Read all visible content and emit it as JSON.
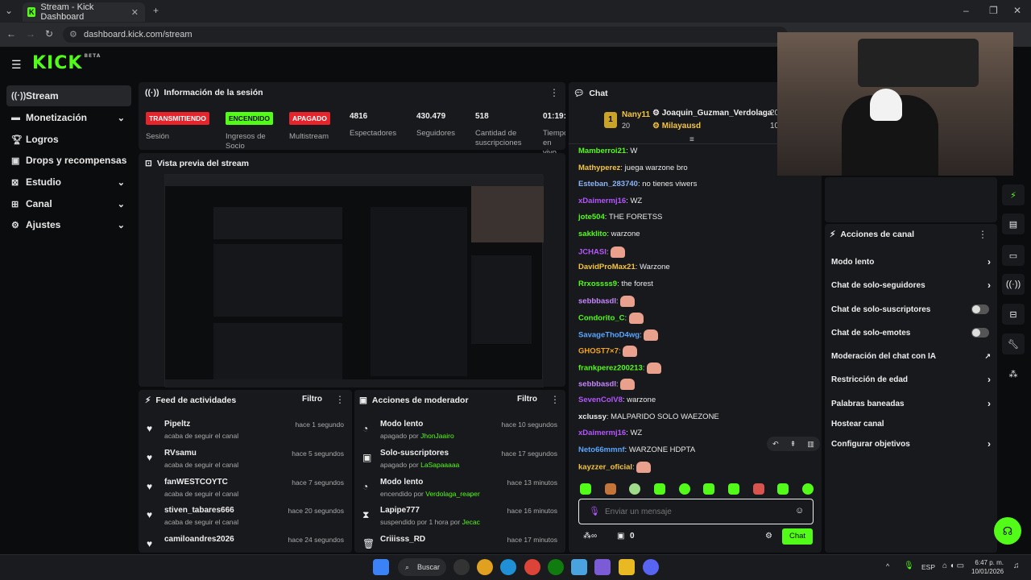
{
  "browser": {
    "tab_title": "Stream - Kick Dashboard",
    "url": "dashboard.kick.com/stream",
    "favicon": "K"
  },
  "logo": {
    "text": "KICK",
    "beta": "BETA"
  },
  "sidebar": {
    "items": [
      {
        "label": "Stream",
        "icon": "radio-icon"
      },
      {
        "label": "Monetización",
        "icon": "money-icon"
      },
      {
        "label": "Logros",
        "icon": "trophy-icon"
      },
      {
        "label": "Drops y recompensas",
        "icon": "gift-icon"
      },
      {
        "label": "Estudio",
        "icon": "studio-icon"
      },
      {
        "label": "Canal",
        "icon": "channel-icon"
      },
      {
        "label": "Ajustes",
        "icon": "gear-icon"
      }
    ]
  },
  "session": {
    "title": "Información de la sesión",
    "badges": [
      {
        "text": "TRANSMITIENDO",
        "label": "Sesión",
        "color": "#e5242c",
        "textcolor": "#ffffff"
      },
      {
        "text": "ENCENDIDO",
        "label": "Ingresos de Socio",
        "color": "#53fc18",
        "textcolor": "#0b0c0e"
      },
      {
        "text": "APAGADO",
        "label": "Multistream",
        "color": "#e5242c",
        "textcolor": "#ffffff"
      }
    ],
    "stats": [
      {
        "value": "4816",
        "label": "Espectadores"
      },
      {
        "value": "430.479",
        "label": "Seguidores"
      },
      {
        "value": "518",
        "label": "Cantidad de suscripciones"
      },
      {
        "value": "01:19:",
        "label": "Tiempo en vivo"
      }
    ]
  },
  "preview": {
    "title": "Vista previa del stream"
  },
  "feed": {
    "title": "Feed de actividades",
    "filter": "Filtro",
    "items": [
      {
        "name": "Pipeltz",
        "sub": "acaba de seguir el canal",
        "time": "hace 1 segundo"
      },
      {
        "name": "RVsamu",
        "sub": "acaba de seguir el canal",
        "time": "hace 5 segundos"
      },
      {
        "name": "fanWESTCOYTC",
        "sub": "acaba de seguir el canal",
        "time": "hace 7 segundos"
      },
      {
        "name": "stiven_tabares666",
        "sub": "acaba de seguir el canal",
        "time": "hace 20 segundos"
      },
      {
        "name": "camiloandres2026",
        "sub": "acaba de seguir el canal",
        "time": "hace 24 segundos"
      }
    ]
  },
  "modactions": {
    "title": "Acciones de moderador",
    "filter": "Filtro",
    "items": [
      {
        "name": "Modo lento",
        "sub_pre": "apagado por ",
        "sub_user": "JhonJaairo",
        "time": "hace 10 segundos"
      },
      {
        "name": "Solo-suscriptores",
        "sub_pre": "apagado por ",
        "sub_user": "LaSapaaaaa",
        "time": "hace 17 segundos"
      },
      {
        "name": "Modo lento",
        "sub_pre": "encendido por ",
        "sub_user": "Verdolaga_reaper",
        "time": "hace 13 minutos"
      },
      {
        "name": "Lapipe777",
        "sub_pre": "suspendido por 1 hora por ",
        "sub_user": "Jecac",
        "time": "hace 16 minutos"
      },
      {
        "name": "Criiisss_RD",
        "sub_pre": "",
        "sub_user": "",
        "time": "hace 17 minutos"
      }
    ]
  },
  "chat": {
    "title": "Chat",
    "pinned": {
      "rank": "1",
      "user": "Nany11",
      "count": "20",
      "user2": "Joaquin_Guzman_Verdolaga",
      "count2": "20",
      "user3": "Milayausd",
      "count3": "10"
    },
    "messages": [
      {
        "user": "Mamberroi21",
        "color": "#53fc18",
        "text": "W"
      },
      {
        "user": "Mathyperez",
        "color": "#f5c542",
        "text": "juega warzone bro"
      },
      {
        "user": "Esteban_283740",
        "color": "#8ab4f8",
        "text": "no tienes viwers"
      },
      {
        "user": "xDaimermj16",
        "color": "#b455ff",
        "text": "WZ"
      },
      {
        "user": "jote504",
        "color": "#53fc18",
        "text": "THE FORETSS"
      },
      {
        "user": "sakklito",
        "color": "#53fc18",
        "text": "warzone"
      },
      {
        "user": "JCHASI",
        "color": "#b455ff",
        "text": ""
      },
      {
        "user": "DavidProMax21",
        "color": "#f5c542",
        "text": "Warzone"
      },
      {
        "user": "Rrxossss9",
        "color": "#53fc18",
        "text": "the forest"
      },
      {
        "user": "sebbbasdl",
        "color": "#c686ff",
        "text": ""
      },
      {
        "user": "Condorito_C",
        "color": "#53fc18",
        "text": ""
      },
      {
        "user": "SavageThoD4wg",
        "color": "#58a6ff",
        "text": ""
      },
      {
        "user": "GHOST7×7",
        "color": "#f5a623",
        "text": ""
      },
      {
        "user": "frankperez200213",
        "color": "#53fc18",
        "text": ""
      },
      {
        "user": "sebbbasdl",
        "color": "#c686ff",
        "text": ""
      },
      {
        "user": "SevenColV8",
        "color": "#b455ff",
        "text": "warzone"
      },
      {
        "user": "xclussy",
        "color": "#eeeeee",
        "text": "MALPARIDO SOLO WAEZONE"
      },
      {
        "user": "xDaimermj16",
        "color": "#b455ff",
        "text": "WZ"
      },
      {
        "user": "Neto66mmnf",
        "color": "#58a6ff",
        "text": "WARZONE HDPTA"
      },
      {
        "user": "kayzzer_oficial",
        "color": "#f5c542",
        "text": ""
      }
    ],
    "input_placeholder": "Enviar un mensaje",
    "send_label": "Chat",
    "gift_count": "0"
  },
  "channel_actions": {
    "title": "Acciones de canal",
    "items": [
      {
        "label": "Modo lento",
        "kind": "arrow"
      },
      {
        "label": "Chat de solo-seguidores",
        "kind": "arrow"
      },
      {
        "label": "Chat de solo-suscriptores",
        "kind": "toggle"
      },
      {
        "label": "Chat de solo-emotes",
        "kind": "toggle"
      },
      {
        "label": "Moderación del chat con IA",
        "kind": "external"
      },
      {
        "label": "Restricción de edad",
        "kind": "arrow"
      },
      {
        "label": "Palabras baneadas",
        "kind": "arrow"
      },
      {
        "label": "Hostear canal",
        "kind": "none"
      },
      {
        "label": "Configurar objetivos",
        "kind": "arrow"
      }
    ]
  },
  "taskbar": {
    "search_label": "Buscar",
    "lang": "ESP",
    "time": "6:47 p. m.",
    "date": "10/01/2026"
  }
}
